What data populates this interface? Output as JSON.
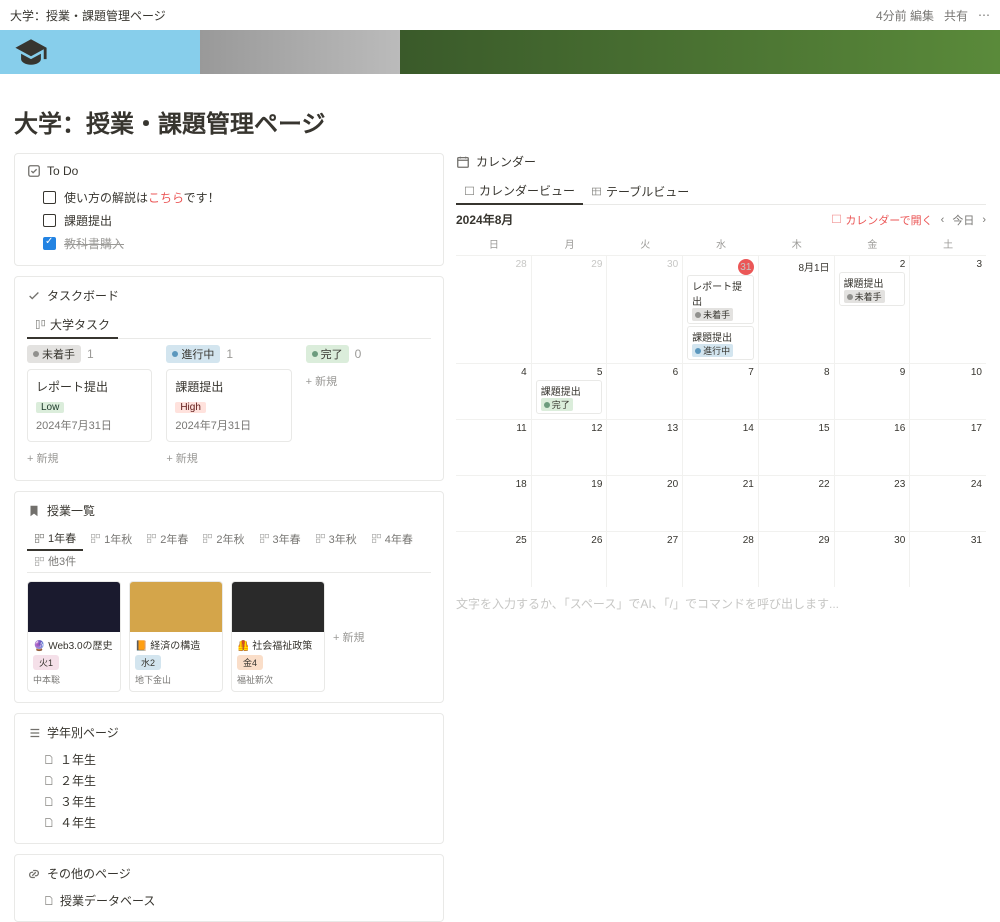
{
  "topbar": {
    "breadcrumb": "大学：授業・課題管理ページ",
    "edited": "4分前 編集",
    "share": "共有"
  },
  "page": {
    "title": "大学：授業・課題管理ページ"
  },
  "todo": {
    "heading": "To Do",
    "items": [
      {
        "checked": false,
        "text_pre": "使い方の解説は",
        "link": "こちら",
        "text_post": "です！"
      },
      {
        "checked": false,
        "text": "課題提出"
      },
      {
        "checked": true,
        "text": "教科書購入"
      }
    ]
  },
  "taskboard": {
    "heading": "タスクボード",
    "tab": "大学タスク",
    "columns": [
      {
        "status": "未着手",
        "count": 1,
        "color": "gray",
        "cards": [
          {
            "title": "レポート提出",
            "priority": "Low",
            "priority_class": "badge-low",
            "date": "2024年7月31日"
          }
        ]
      },
      {
        "status": "進行中",
        "count": 1,
        "color": "blue",
        "cards": [
          {
            "title": "課題提出",
            "priority": "High",
            "priority_class": "badge-high",
            "date": "2024年7月31日"
          }
        ]
      },
      {
        "status": "完了",
        "count": 0,
        "color": "green",
        "cards": []
      }
    ],
    "addnew": "+ 新規"
  },
  "classes": {
    "heading": "授業一覧",
    "tabs": [
      "1年春",
      "1年秋",
      "2年春",
      "2年秋",
      "3年春",
      "3年秋",
      "4年春",
      "他3件"
    ],
    "active_tab": 0,
    "cards": [
      {
        "icon": "🔮",
        "title": "Web3.0の歴史",
        "tag": "火1",
        "tag_class": "tag-pink",
        "prof": "中本聡",
        "img": "#1a1a2e"
      },
      {
        "icon": "📙",
        "title": "経済の構造",
        "tag": "水2",
        "tag_class": "tag-blue",
        "prof": "地下金山",
        "img": "#d4a54a"
      },
      {
        "icon": "🦺",
        "title": "社会福祉政策",
        "tag": "金4",
        "tag_class": "tag-orange",
        "prof": "福祉新次",
        "img": "#2a2a2a"
      }
    ],
    "addnew": "+ 新規"
  },
  "gradepage": {
    "heading": "学年別ページ",
    "items": [
      "１年生",
      "２年生",
      "３年生",
      "４年生"
    ]
  },
  "other": {
    "heading": "その他のページ",
    "items": [
      "授業データベース"
    ]
  },
  "calendar": {
    "heading": "カレンダー",
    "tabs": [
      "カレンダービュー",
      "テーブルビュー"
    ],
    "month": "2024年8月",
    "open_label": "カレンダーで開く",
    "today_label": "今日",
    "dow": [
      "日",
      "月",
      "火",
      "水",
      "木",
      "金",
      "土"
    ],
    "weeks": [
      {
        "days": [
          {
            "n": 28,
            "other": true
          },
          {
            "n": 29,
            "other": true
          },
          {
            "n": 30,
            "other": true
          },
          {
            "n": 31,
            "other": true,
            "today": true,
            "events": [
              {
                "t": "レポート提出",
                "status": "未着手",
                "sc": "tag-gray",
                "dc": "dot-gray"
              },
              {
                "t": "課題提出",
                "status": "進行中",
                "sc": "tag-blue",
                "dc": "dot-blue"
              }
            ]
          },
          {
            "n": "8月1日"
          },
          {
            "n": 2,
            "events": [
              {
                "t": "課題提出",
                "status": "未着手",
                "sc": "tag-gray",
                "dc": "dot-gray"
              }
            ]
          },
          {
            "n": 3
          }
        ]
      },
      {
        "days": [
          {
            "n": 4
          },
          {
            "n": 5,
            "events": [
              {
                "t": "課題提出",
                "status": "完了",
                "sc": "tag-green",
                "dc": "dot-green"
              }
            ]
          },
          {
            "n": 6
          },
          {
            "n": 7
          },
          {
            "n": 8
          },
          {
            "n": 9
          },
          {
            "n": 10
          }
        ]
      },
      {
        "days": [
          {
            "n": 11
          },
          {
            "n": 12
          },
          {
            "n": 13
          },
          {
            "n": 14
          },
          {
            "n": 15
          },
          {
            "n": 16
          },
          {
            "n": 17
          }
        ]
      },
      {
        "days": [
          {
            "n": 18
          },
          {
            "n": 19
          },
          {
            "n": 20
          },
          {
            "n": 21
          },
          {
            "n": 22
          },
          {
            "n": 23
          },
          {
            "n": 24
          }
        ]
      },
      {
        "days": [
          {
            "n": 25
          },
          {
            "n": 26
          },
          {
            "n": 27
          },
          {
            "n": 28
          },
          {
            "n": 29
          },
          {
            "n": 30
          },
          {
            "n": 31
          }
        ]
      }
    ],
    "placeholder": "文字を入力するか、「スペース」でAI、「/」でコマンドを呼び出します..."
  }
}
